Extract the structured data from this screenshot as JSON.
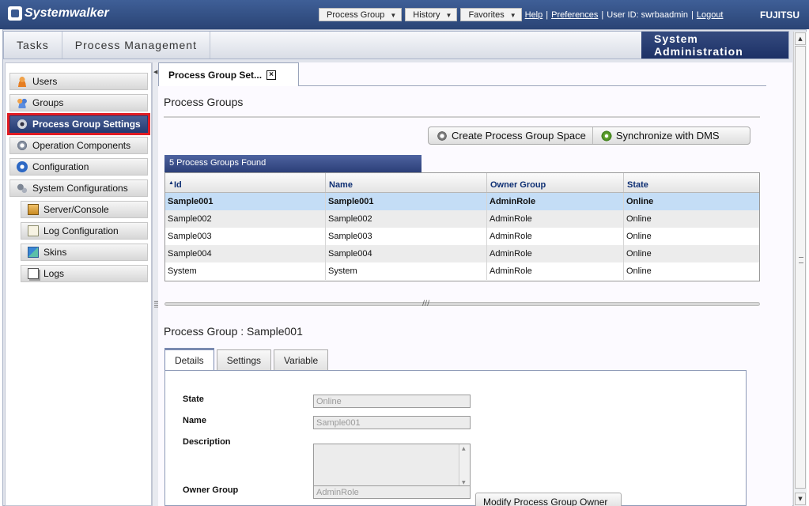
{
  "header": {
    "brand": "Systemwalker",
    "menus": [
      "Process Group",
      "History",
      "Favorites"
    ],
    "links": [
      "Help",
      "Preferences"
    ],
    "user_id": "User ID: swrbaadmin",
    "logout": "Logout",
    "vendor": "FUJITSU"
  },
  "tabs": {
    "items": [
      "Tasks",
      "Process Management"
    ],
    "admin": "System Administration"
  },
  "sidebar": {
    "items": [
      {
        "label": "Users",
        "icon": "users-icon"
      },
      {
        "label": "Groups",
        "icon": "groups-icon"
      },
      {
        "label": "Process Group Settings",
        "icon": "gear-icon",
        "selected": true
      },
      {
        "label": "Operation Components",
        "icon": "gear-icon"
      },
      {
        "label": "Configuration",
        "icon": "configuration-icon"
      },
      {
        "label": "System Configurations",
        "icon": "system-config-icon"
      },
      {
        "label": "Server/Console",
        "icon": "server-console-icon"
      },
      {
        "label": "Log Configuration",
        "icon": "log-config-icon"
      },
      {
        "label": "Skins",
        "icon": "skins-icon"
      },
      {
        "label": "Logs",
        "icon": "logs-icon"
      }
    ]
  },
  "main": {
    "page_tab": "Process Group Set...",
    "heading": "Process Groups",
    "buttons": {
      "create": "Create Process Group Space",
      "sync": "Synchronize with DMS"
    },
    "found": "5 Process Groups Found",
    "columns": [
      "Id",
      "Name",
      "Owner Group",
      "State"
    ],
    "rows": [
      [
        "Sample001",
        "Sample001",
        "AdminRole",
        "Online"
      ],
      [
        "Sample002",
        "Sample002",
        "AdminRole",
        "Online"
      ],
      [
        "Sample003",
        "Sample003",
        "AdminRole",
        "Online"
      ],
      [
        "Sample004",
        "Sample004",
        "AdminRole",
        "Online"
      ],
      [
        "System",
        "System",
        "AdminRole",
        "Online"
      ]
    ],
    "detail": {
      "heading": "Process Group : Sample001",
      "tabs": [
        "Details",
        "Settings",
        "Variable"
      ],
      "fields": {
        "state_label": "State",
        "state_value": "Online",
        "name_label": "Name",
        "name_value": "Sample001",
        "description_label": "Description",
        "owner_label": "Owner Group",
        "owner_value": "AdminRole",
        "modify_button": "Modify Process Group Owner"
      }
    }
  }
}
